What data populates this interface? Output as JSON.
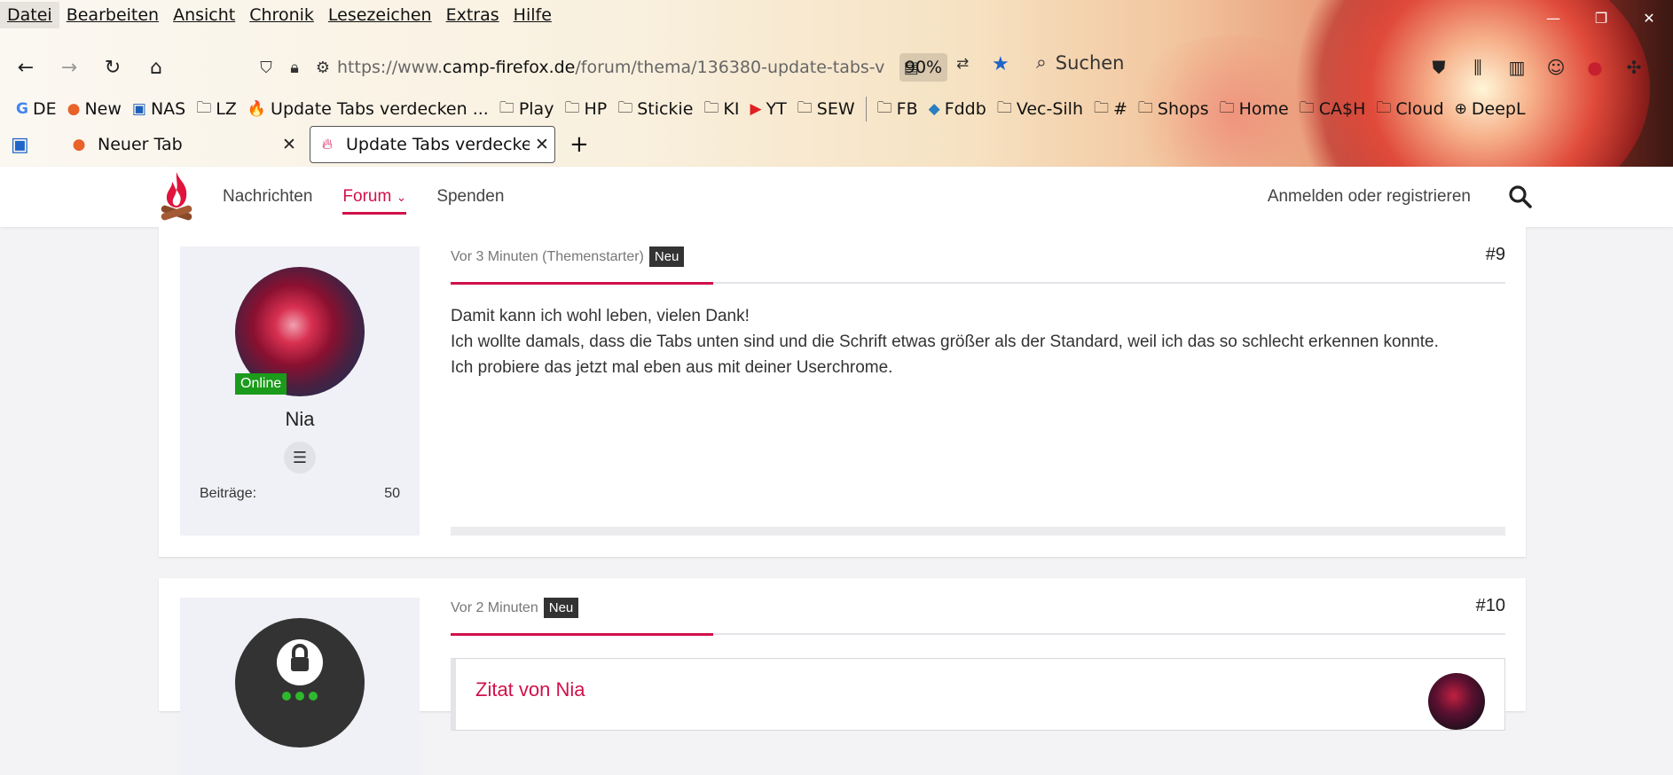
{
  "menubar": {
    "items": [
      "Datei",
      "Bearbeiten",
      "Ansicht",
      "Chronik",
      "Lesezeichen",
      "Extras",
      "Hilfe"
    ]
  },
  "window": {
    "minimize": "—",
    "restore": "❐",
    "close": "✕"
  },
  "navbar": {
    "url_prefix": "https://www.",
    "url_host": "camp-firefox.de",
    "url_path": "/forum/thema/136380-update-tabs-v",
    "zoom": "90%",
    "search_label": "Suchen"
  },
  "bookmarks": [
    {
      "icon": "G",
      "label": "DE"
    },
    {
      "icon": "●",
      "label": "New"
    },
    {
      "icon": "▣",
      "label": "NAS"
    },
    {
      "icon": "🗀",
      "label": "LZ"
    },
    {
      "icon": "🔥",
      "label": "Update Tabs verdecken ..."
    },
    {
      "icon": "🗀",
      "label": "Play"
    },
    {
      "icon": "🗀",
      "label": "HP"
    },
    {
      "icon": "🗀",
      "label": "Stickie"
    },
    {
      "icon": "🗀",
      "label": "KI"
    },
    {
      "icon": "▶",
      "label": "YT"
    },
    {
      "icon": "🗀",
      "label": "SEW"
    },
    {
      "icon": "🗀",
      "label": "FB"
    },
    {
      "icon": "◆",
      "label": "Fddb"
    },
    {
      "icon": "🗀",
      "label": "Vec-Silh"
    },
    {
      "icon": "🗀",
      "label": "#"
    },
    {
      "icon": "🗀",
      "label": "Shops"
    },
    {
      "icon": "🗀",
      "label": "Home"
    },
    {
      "icon": "🗀",
      "label": "CA$H"
    },
    {
      "icon": "🗀",
      "label": "Cloud"
    },
    {
      "icon": "⊕",
      "label": "DeepL"
    }
  ],
  "tabs": [
    {
      "label": "Neuer Tab",
      "close": "✕"
    },
    {
      "label": "Update Tabs verdecken",
      "close": "✕"
    }
  ],
  "newtab": "+",
  "site": {
    "nav": [
      "Nachrichten",
      "Forum",
      "Spenden"
    ],
    "forum_caret": "⌄",
    "login": "Anmelden oder registrieren"
  },
  "posts": [
    {
      "meta": "Vor 3 Minuten (Themenstarter)",
      "badge": "Neu",
      "number": "#9",
      "online": "Online",
      "username": "Nia",
      "stat_label": "Beiträge",
      "stat_value": "50",
      "lines": [
        "Damit kann ich wohl leben, vielen Dank!",
        "Ich wollte damals, dass die Tabs unten sind und die Schrift etwas größer als der Standard, weil ich das so schlecht erkennen konnte.",
        "Ich probiere das jetzt mal eben aus mit deiner Userchrome."
      ]
    },
    {
      "meta": "Vor 2 Minuten",
      "badge": "Neu",
      "number": "#10",
      "quote_title": "Zitat von Nia"
    }
  ],
  "colors": {
    "accent": "#d1114b",
    "online": "#1b9a1b"
  }
}
